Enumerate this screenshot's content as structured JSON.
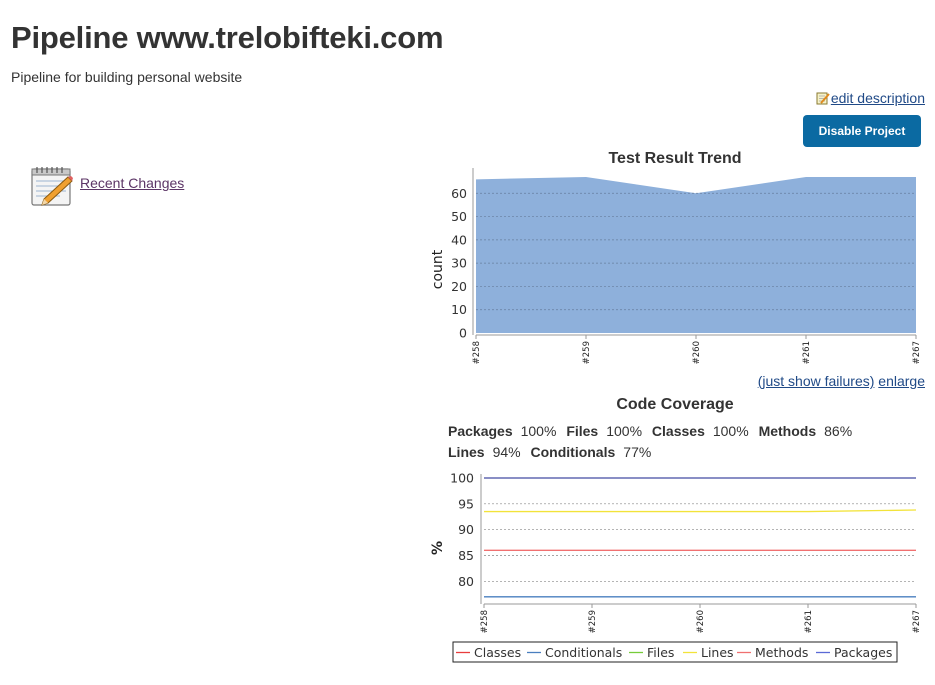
{
  "page": {
    "title": "Pipeline www.trelobifteki.com",
    "description": "Pipeline for building personal website",
    "edit_description": "edit description",
    "disable_button": "Disable Project"
  },
  "side": {
    "recent_changes": "Recent Changes"
  },
  "trend": {
    "just_show_failures": "(just show failures)",
    "enlarge": "enlarge"
  },
  "coverage": {
    "metrics": [
      {
        "label": "Packages",
        "value": "100%"
      },
      {
        "label": "Files",
        "value": "100%"
      },
      {
        "label": "Classes",
        "value": "100%"
      },
      {
        "label": "Methods",
        "value": "86%"
      },
      {
        "label": "Lines",
        "value": "94%"
      },
      {
        "label": "Conditionals",
        "value": "77%"
      }
    ]
  },
  "chart_data": [
    {
      "type": "area",
      "title": "Test Result Trend",
      "xlabel": "",
      "ylabel": "count",
      "categories": [
        "#258",
        "#259",
        "#260",
        "#261",
        "#267"
      ],
      "series": [
        {
          "values": [
            66,
            67,
            60,
            67,
            67
          ],
          "color": "#8eb0db"
        }
      ],
      "ylim": [
        0,
        70
      ],
      "yticks": [
        0,
        10,
        20,
        30,
        40,
        50,
        60
      ],
      "grid": true
    },
    {
      "type": "line",
      "title": "Code Coverage",
      "xlabel": "",
      "ylabel": "%",
      "categories": [
        "#258",
        "#259",
        "#260",
        "#261",
        "#267"
      ],
      "series": [
        {
          "name": "Classes",
          "values": [
            100,
            100,
            100,
            100,
            100
          ],
          "color": "#e83d3d"
        },
        {
          "name": "Conditionals",
          "values": [
            77,
            77,
            77,
            77,
            77
          ],
          "color": "#4a7fbf"
        },
        {
          "name": "Files",
          "values": [
            100,
            100,
            100,
            100,
            100
          ],
          "color": "#77cc3a"
        },
        {
          "name": "Lines",
          "values": [
            93.5,
            93.5,
            93.5,
            93.5,
            93.8
          ],
          "color": "#f2e33a"
        },
        {
          "name": "Methods",
          "values": [
            86,
            86,
            86,
            86,
            86
          ],
          "color": "#f07070"
        },
        {
          "name": "Packages",
          "values": [
            100,
            100,
            100,
            100,
            100
          ],
          "color": "#5a6ad6"
        }
      ],
      "ylim": [
        76,
        100
      ],
      "yticks": [
        80,
        85,
        90,
        95,
        100
      ],
      "legend": "bottom",
      "grid": true
    }
  ]
}
